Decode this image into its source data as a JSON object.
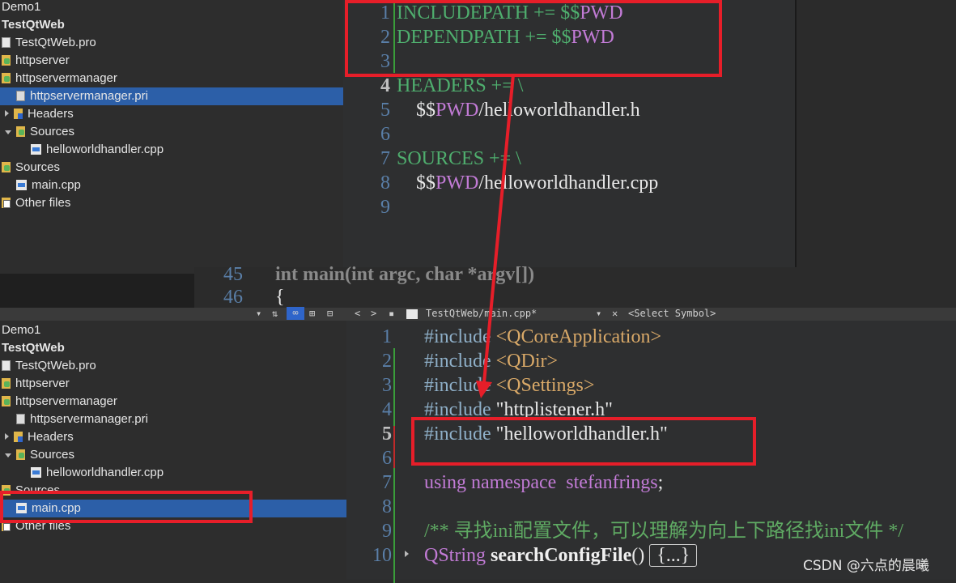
{
  "top_tree": {
    "items": [
      {
        "label": "Demo1",
        "icon": "none",
        "indent": 0,
        "bold": false,
        "selected": false
      },
      {
        "label": "TestQtWeb",
        "icon": "none",
        "indent": 0,
        "bold": true,
        "selected": false
      },
      {
        "label": "TestQtWeb.pro",
        "icon": "pro-file-icon",
        "indent": 0,
        "bold": false,
        "selected": false
      },
      {
        "label": "httpserver",
        "icon": "qt-folder-icon",
        "indent": 0,
        "bold": false,
        "selected": false
      },
      {
        "label": "httpservermanager",
        "icon": "qt-folder-icon",
        "indent": 0,
        "bold": false,
        "selected": false
      },
      {
        "label": "httpservermanager.pri",
        "icon": "pri-file-icon",
        "indent": 1,
        "bold": false,
        "selected": true
      },
      {
        "label": "Headers",
        "icon": "headers-folder-icon",
        "indent": 1,
        "bold": false,
        "selected": false,
        "tri": "right"
      },
      {
        "label": "Sources",
        "icon": "sources-folder-icon",
        "indent": 1,
        "bold": false,
        "selected": false,
        "tri": "down"
      },
      {
        "label": "helloworldhandler.cpp",
        "icon": "cpp-file-icon",
        "indent": 2,
        "bold": false,
        "selected": false
      },
      {
        "label": "Sources",
        "icon": "sources-folder-icon",
        "indent": 0,
        "bold": false,
        "selected": false
      },
      {
        "label": "main.cpp",
        "icon": "cpp-file-icon",
        "indent": 1,
        "bold": false,
        "selected": false
      },
      {
        "label": "Other files",
        "icon": "other-files-icon",
        "indent": 0,
        "bold": false,
        "selected": false
      }
    ]
  },
  "top_editor": {
    "lines": [
      {
        "n": "1",
        "parts": [
          {
            "t": "INCLUDEPATH += $$",
            "c": "grn"
          },
          {
            "t": "PWD",
            "c": "kw"
          }
        ]
      },
      {
        "n": "2",
        "parts": [
          {
            "t": "DEPENDPATH += $$",
            "c": "grn"
          },
          {
            "t": "PWD",
            "c": "kw"
          }
        ]
      },
      {
        "n": "3",
        "parts": []
      },
      {
        "n": "4",
        "parts": [
          {
            "t": "HEADERS += \\",
            "c": "grn"
          }
        ],
        "bold": true
      },
      {
        "n": "5",
        "parts": [
          {
            "t": "    $$",
            "c": "wh"
          },
          {
            "t": "PWD",
            "c": "kw"
          },
          {
            "t": "/helloworldhandler.h",
            "c": "wh"
          }
        ]
      },
      {
        "n": "6",
        "parts": []
      },
      {
        "n": "7",
        "parts": [
          {
            "t": "SOURCES += \\",
            "c": "grn"
          }
        ]
      },
      {
        "n": "8",
        "parts": [
          {
            "t": "    $$",
            "c": "wh"
          },
          {
            "t": "PWD",
            "c": "kw"
          },
          {
            "t": "/helloworldhandler.cpp",
            "c": "wh"
          }
        ]
      },
      {
        "n": "9",
        "parts": []
      }
    ]
  },
  "behind_editor": {
    "line45": {
      "n": "45",
      "code": "int main(int argc, char *argv[])"
    },
    "line46": {
      "n": "46",
      "code": "{"
    }
  },
  "toolbar": {
    "file_path": "TestQtWeb/main.cpp*",
    "symbol": "<Select Symbol>",
    "back_arrow": "<",
    "forward_arrow": ">",
    "close": "✕"
  },
  "bottom_tree": {
    "items": [
      {
        "label": "Demo1",
        "icon": "none",
        "indent": 0,
        "bold": false,
        "selected": false
      },
      {
        "label": "TestQtWeb",
        "icon": "none",
        "indent": 0,
        "bold": true,
        "selected": false
      },
      {
        "label": "TestQtWeb.pro",
        "icon": "pro-file-icon",
        "indent": 0,
        "bold": false,
        "selected": false
      },
      {
        "label": "httpserver",
        "icon": "qt-folder-icon",
        "indent": 0,
        "bold": false,
        "selected": false
      },
      {
        "label": "httpservermanager",
        "icon": "qt-folder-icon",
        "indent": 0,
        "bold": false,
        "selected": false
      },
      {
        "label": "httpservermanager.pri",
        "icon": "pri-file-icon",
        "indent": 1,
        "bold": false,
        "selected": false
      },
      {
        "label": "Headers",
        "icon": "headers-folder-icon",
        "indent": 1,
        "bold": false,
        "selected": false,
        "tri": "right"
      },
      {
        "label": "Sources",
        "icon": "sources-folder-icon",
        "indent": 1,
        "bold": false,
        "selected": false,
        "tri": "down"
      },
      {
        "label": "helloworldhandler.cpp",
        "icon": "cpp-file-icon",
        "indent": 2,
        "bold": false,
        "selected": false
      },
      {
        "label": "Sources",
        "icon": "sources-folder-icon",
        "indent": 0,
        "bold": false,
        "selected": false
      },
      {
        "label": "main.cpp",
        "icon": "cpp-file-icon",
        "indent": 1,
        "bold": false,
        "selected": true
      },
      {
        "label": "Other files",
        "icon": "other-files-icon",
        "indent": 0,
        "bold": false,
        "selected": false
      }
    ]
  },
  "bottom_editor": {
    "lines": [
      {
        "n": "1",
        "parts": [
          {
            "t": "#include ",
            "c": "inc"
          },
          {
            "t": "<QCoreApplication>",
            "c": "str"
          }
        ]
      },
      {
        "n": "2",
        "parts": [
          {
            "t": "#include ",
            "c": "inc"
          },
          {
            "t": "<QDir>",
            "c": "str"
          }
        ]
      },
      {
        "n": "3",
        "parts": [
          {
            "t": "#include ",
            "c": "inc"
          },
          {
            "t": "<QSettings>",
            "c": "str"
          }
        ]
      },
      {
        "n": "4",
        "parts": [
          {
            "t": "#include ",
            "c": "inc"
          },
          {
            "t": "\"httplistener.h\"",
            "c": "wh"
          }
        ]
      },
      {
        "n": "5",
        "parts": [
          {
            "t": "#include ",
            "c": "inc"
          },
          {
            "t": "\"helloworldhandler.h\"",
            "c": "wh"
          }
        ],
        "bold": true
      },
      {
        "n": "6",
        "parts": []
      },
      {
        "n": "7",
        "parts": [
          {
            "t": "using namespace  stefanfrings",
            "c": "kw"
          },
          {
            "t": ";",
            "c": "wh"
          }
        ]
      },
      {
        "n": "8",
        "parts": []
      },
      {
        "n": "9",
        "parts": [
          {
            "t": "/** 寻找ini配置文件，可以理解为向上下路径找ini文件 */",
            "c": "com"
          }
        ]
      },
      {
        "n": "10",
        "parts": [
          {
            "t": "QString ",
            "c": "typ"
          },
          {
            "t": "searchConfigFile",
            "c": "fn"
          },
          {
            "t": "() ",
            "c": "wh"
          },
          {
            "t": "{...}",
            "c": "wh",
            "box": true
          }
        ]
      }
    ]
  },
  "watermark": "CSDN @六点的晨曦",
  "colors": {
    "accent": "#e61e29",
    "selection": "#2f65ca",
    "background": "#2b2b2b"
  }
}
